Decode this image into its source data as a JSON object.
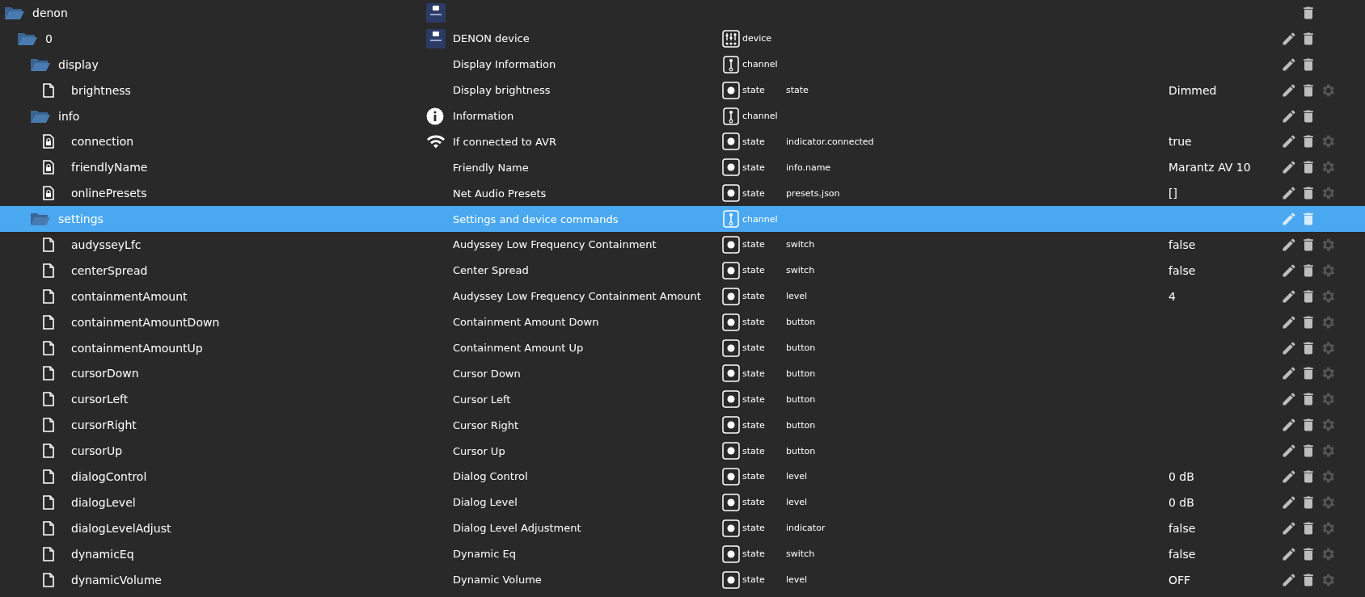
{
  "tree": [
    {
      "name": "denon",
      "kind": "folder",
      "expanded": true,
      "selected": false,
      "icon": {
        "kind": "logo"
      },
      "actions": {
        "edit": false,
        "settings": false
      },
      "children": [
        {
          "name": "0",
          "kind": "folder",
          "expanded": true,
          "selected": false,
          "icon": {
            "kind": "logo"
          },
          "title": "DENON device",
          "type": {
            "kind": "device",
            "label": "device"
          },
          "actions": {
            "edit": true,
            "settings": false
          },
          "children": [
            {
              "name": "display",
              "kind": "folder",
              "expanded": true,
              "selected": false,
              "title": "Display Information",
              "type": {
                "kind": "channel",
                "label": "channel"
              },
              "actions": {
                "edit": true,
                "settings": false
              },
              "children": [
                {
                  "name": "brightness",
                  "kind": "file",
                  "selected": false,
                  "title": "Display brightness",
                  "type": {
                    "kind": "state",
                    "label": "state"
                  },
                  "role": "state",
                  "value": "Dimmed",
                  "actions": {
                    "edit": true,
                    "settings": true
                  }
                }
              ]
            },
            {
              "name": "info",
              "kind": "folder",
              "expanded": true,
              "selected": false,
              "icon": {
                "kind": "info"
              },
              "title": "Information",
              "type": {
                "kind": "channel",
                "label": "channel"
              },
              "actions": {
                "edit": true,
                "settings": false
              },
              "children": [
                {
                  "name": "connection",
                  "kind": "locked",
                  "selected": false,
                  "icon": {
                    "kind": "wifi"
                  },
                  "title": "If connected to AVR",
                  "type": {
                    "kind": "state",
                    "label": "state"
                  },
                  "role": "indicator.connected",
                  "value": "true",
                  "actions": {
                    "edit": true,
                    "settings": true
                  }
                },
                {
                  "name": "friendlyName",
                  "kind": "locked",
                  "selected": false,
                  "title": "Friendly Name",
                  "type": {
                    "kind": "state",
                    "label": "state"
                  },
                  "role": "info.name",
                  "value": "Marantz AV 10",
                  "actions": {
                    "edit": true,
                    "settings": true
                  }
                },
                {
                  "name": "onlinePresets",
                  "kind": "locked",
                  "selected": false,
                  "title": "Net Audio Presets",
                  "type": {
                    "kind": "state",
                    "label": "state"
                  },
                  "role": "presets.json",
                  "value": "[]",
                  "actions": {
                    "edit": true,
                    "settings": true
                  }
                }
              ]
            },
            {
              "name": "settings",
              "kind": "folder",
              "expanded": true,
              "selected": true,
              "title": "Settings and device commands",
              "type": {
                "kind": "channel",
                "label": "channel"
              },
              "actions": {
                "edit": true,
                "settings": false
              },
              "children": [
                {
                  "name": "audysseyLfc",
                  "kind": "file",
                  "selected": false,
                  "title": "Audyssey Low Frequency Containment",
                  "type": {
                    "kind": "state",
                    "label": "state"
                  },
                  "role": "switch",
                  "value": "false",
                  "actions": {
                    "edit": true,
                    "settings": true
                  }
                },
                {
                  "name": "centerSpread",
                  "kind": "file",
                  "selected": false,
                  "title": "Center Spread",
                  "type": {
                    "kind": "state",
                    "label": "state"
                  },
                  "role": "switch",
                  "value": "false",
                  "actions": {
                    "edit": true,
                    "settings": true
                  }
                },
                {
                  "name": "containmentAmount",
                  "kind": "file",
                  "selected": false,
                  "title": "Audyssey Low Frequency Containment Amount",
                  "type": {
                    "kind": "state",
                    "label": "state"
                  },
                  "role": "level",
                  "value": "4",
                  "actions": {
                    "edit": true,
                    "settings": true
                  }
                },
                {
                  "name": "containmentAmountDown",
                  "kind": "file",
                  "selected": false,
                  "title": "Containment Amount Down",
                  "type": {
                    "kind": "state",
                    "label": "state"
                  },
                  "role": "button",
                  "actions": {
                    "edit": true,
                    "settings": true
                  }
                },
                {
                  "name": "containmentAmountUp",
                  "kind": "file",
                  "selected": false,
                  "title": "Containment Amount Up",
                  "type": {
                    "kind": "state",
                    "label": "state"
                  },
                  "role": "button",
                  "actions": {
                    "edit": true,
                    "settings": true
                  }
                },
                {
                  "name": "cursorDown",
                  "kind": "file",
                  "selected": false,
                  "title": "Cursor Down",
                  "type": {
                    "kind": "state",
                    "label": "state"
                  },
                  "role": "button",
                  "actions": {
                    "edit": true,
                    "settings": true
                  }
                },
                {
                  "name": "cursorLeft",
                  "kind": "file",
                  "selected": false,
                  "title": "Cursor Left",
                  "type": {
                    "kind": "state",
                    "label": "state"
                  },
                  "role": "button",
                  "actions": {
                    "edit": true,
                    "settings": true
                  }
                },
                {
                  "name": "cursorRight",
                  "kind": "file",
                  "selected": false,
                  "title": "Cursor Right",
                  "type": {
                    "kind": "state",
                    "label": "state"
                  },
                  "role": "button",
                  "actions": {
                    "edit": true,
                    "settings": true
                  }
                },
                {
                  "name": "cursorUp",
                  "kind": "file",
                  "selected": false,
                  "title": "Cursor Up",
                  "type": {
                    "kind": "state",
                    "label": "state"
                  },
                  "role": "button",
                  "actions": {
                    "edit": true,
                    "settings": true
                  }
                },
                {
                  "name": "dialogControl",
                  "kind": "file",
                  "selected": false,
                  "title": "Dialog Control",
                  "type": {
                    "kind": "state",
                    "label": "state"
                  },
                  "role": "level",
                  "value": "0 dB",
                  "actions": {
                    "edit": true,
                    "settings": true
                  }
                },
                {
                  "name": "dialogLevel",
                  "kind": "file",
                  "selected": false,
                  "title": "Dialog Level",
                  "type": {
                    "kind": "state",
                    "label": "state"
                  },
                  "role": "level",
                  "value": "0 dB",
                  "actions": {
                    "edit": true,
                    "settings": true
                  }
                },
                {
                  "name": "dialogLevelAdjust",
                  "kind": "file",
                  "selected": false,
                  "title": "Dialog Level Adjustment",
                  "type": {
                    "kind": "state",
                    "label": "state"
                  },
                  "role": "indicator",
                  "value": "false",
                  "actions": {
                    "edit": true,
                    "settings": true
                  }
                },
                {
                  "name": "dynamicEq",
                  "kind": "file",
                  "selected": false,
                  "title": "Dynamic Eq",
                  "type": {
                    "kind": "state",
                    "label": "state"
                  },
                  "role": "switch",
                  "value": "false",
                  "actions": {
                    "edit": true,
                    "settings": true
                  }
                },
                {
                  "name": "dynamicVolume",
                  "kind": "file",
                  "selected": false,
                  "title": "Dynamic Volume",
                  "type": {
                    "kind": "state",
                    "label": "state"
                  },
                  "role": "level",
                  "value": "OFF",
                  "actions": {
                    "edit": true,
                    "settings": true
                  }
                }
              ]
            }
          ]
        }
      ]
    }
  ]
}
